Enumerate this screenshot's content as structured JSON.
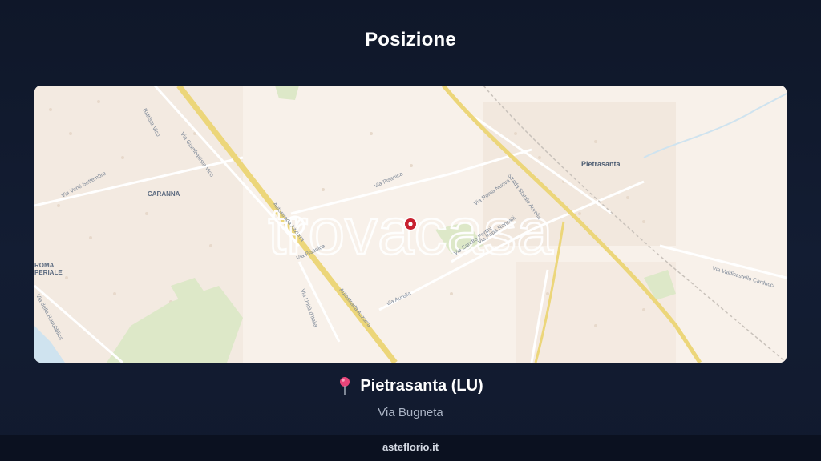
{
  "header": {
    "title": "Posizione"
  },
  "map": {
    "watermark": "trovacasa",
    "labels": {
      "pietrasanta": "Pietrasanta",
      "caranna": "CARANNA",
      "roma_imperiale_1": "ROMA",
      "roma_imperiale_2": "PERIALE",
      "via_vico": "Via Giambattista Vico",
      "via_vico_top": "Battista Vico",
      "via_settembre": "Via Venti Settembre",
      "via_aurelia": "Strada Statale Aurelia",
      "autostrada_1": "Autostrada Azzurra",
      "autostrada_2": "Autostrada Azzurra",
      "via_unita": "Via Unità d'Italia",
      "via_pisanica": "Via Pisanica",
      "via_pisanica_2": "Via Pisanica",
      "via_sandro": "Via Sandro Pertini",
      "via_papa": "Via Papa Roncalli",
      "via_roma_nuova": "Via Roma Nuova",
      "via_aurelia_small": "Via Aurelia",
      "via_valdicastello": "Via Valdicastello Carducci",
      "via_repubblica": "Via della Repubblica"
    },
    "marker_color": "#c8202f",
    "colors": {
      "background": "#f8f1ea",
      "highway": "#ecd67a",
      "green": "#dde8c8",
      "water": "#cfe3ef"
    }
  },
  "location": {
    "pin_icon": "round-pushpin-icon",
    "city": "Pietrasanta (LU)",
    "street": "Via Bugneta"
  },
  "footer": {
    "site": "asteflorio.it"
  }
}
